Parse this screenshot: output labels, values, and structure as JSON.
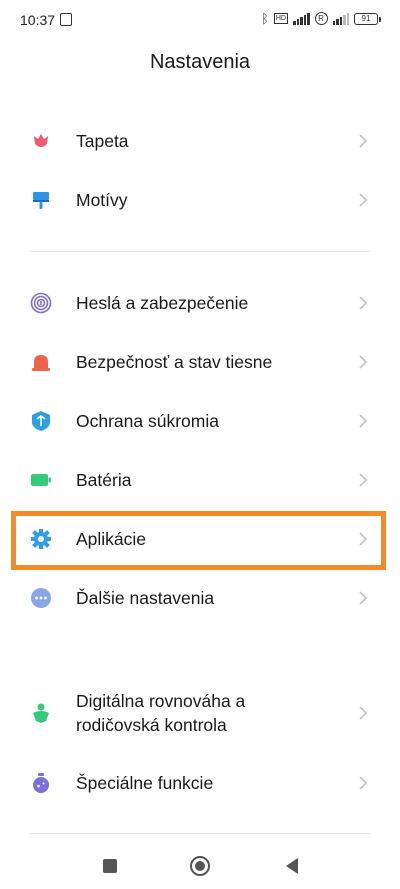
{
  "status_bar": {
    "time": "10:37",
    "hd_badge": "HD",
    "roaming": "R",
    "battery": "91"
  },
  "header": {
    "title": "Nastavenia"
  },
  "sections": [
    {
      "items": [
        {
          "label": "Tapeta",
          "icon": "tulip-icon",
          "color": "#ee5d72"
        },
        {
          "label": "Motívy",
          "icon": "brush-icon",
          "color": "#2f94e8"
        }
      ]
    },
    {
      "items": [
        {
          "label": "Heslá a zabezpečenie",
          "icon": "fingerprint-icon",
          "color": "#7c6fcf"
        },
        {
          "label": "Bezpečnosť a stav tiesne",
          "icon": "alarm-light-icon",
          "color": "#f0634b"
        },
        {
          "label": "Ochrana súkromia",
          "icon": "privacy-shield-icon",
          "color": "#2c9fe6"
        },
        {
          "label": "Batéria",
          "icon": "battery-icon",
          "color": "#35c97a"
        },
        {
          "label": "Aplikácie",
          "icon": "gear-icon",
          "color": "#2c9fe6"
        },
        {
          "label": "Ďalšie nastavenia",
          "icon": "more-dots-icon",
          "color": "#8aa6e8"
        }
      ]
    },
    {
      "items": [
        {
          "label_line1": "Digitálna rovnováha a",
          "label_line2": "rodičovská kontrola",
          "icon": "parent-child-icon",
          "color": "#35c97a"
        },
        {
          "label": "Špeciálne funkcie",
          "icon": "special-features-icon",
          "color": "#7b6fe0"
        }
      ]
    }
  ],
  "highlight_color": "#f28c2a",
  "nav_bar": {
    "recents": "square-icon",
    "home": "circle-icon",
    "back": "triangle-back-icon"
  }
}
